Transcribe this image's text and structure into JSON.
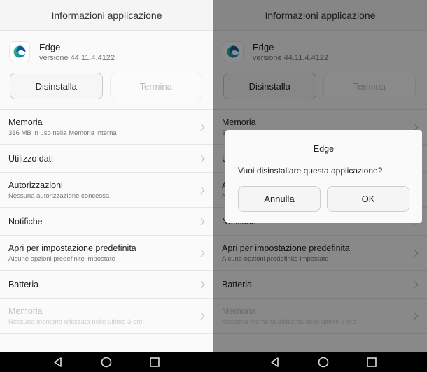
{
  "screen": {
    "title": "Informazioni applicazione",
    "app": {
      "name": "Edge",
      "version": "versione 44.11.4.4122",
      "icon": "edge-logo-icon"
    },
    "buttons": {
      "uninstall": "Disinstalla",
      "stop": "Termina"
    },
    "items": [
      {
        "title": "Memoria",
        "subtitle": "316 MB in uso nella Memoria interna"
      },
      {
        "title": "Utilizzo dati",
        "subtitle": ""
      },
      {
        "title": "Autorizzazioni",
        "subtitle": "Nessuna autorizzazione concessa"
      },
      {
        "title": "Notifiche",
        "subtitle": ""
      },
      {
        "title": "Apri per impostazione predefinita",
        "subtitle": "Alcune opzioni predefinite impostate"
      },
      {
        "title": "Batteria",
        "subtitle": ""
      },
      {
        "title": "Memoria",
        "subtitle": "Nessuna memoria utilizzata nelle ultime 3 ore"
      }
    ]
  },
  "dialog": {
    "title": "Edge",
    "message": "Vuoi disinstallare questa applicazione?",
    "cancel": "Annulla",
    "ok": "OK"
  },
  "navbar": {
    "icons": [
      "back-icon",
      "home-icon",
      "recents-icon"
    ]
  },
  "colors": {
    "edge_blue": "#0c59a4",
    "edge_green": "#46c35c",
    "dim": "rgba(0,0,0,0.45)"
  }
}
